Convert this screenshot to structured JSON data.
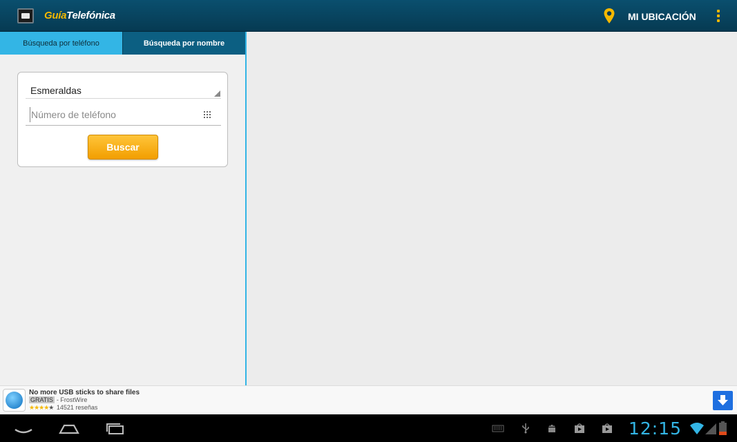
{
  "header": {
    "logo_part1": "Guía",
    "logo_part2": "Telefónica",
    "location_label": "MI UBICACIÓN"
  },
  "tabs": [
    {
      "label": "Búsqueda por teléfono",
      "selected": true
    },
    {
      "label": "Búsqueda por nombre",
      "selected": false
    }
  ],
  "search": {
    "province_value": "Esmeraldas",
    "phone_placeholder": "Número de teléfono",
    "phone_value": "",
    "button_label": "Buscar"
  },
  "ad": {
    "title": "No more USB sticks to share files",
    "price_badge": "GRATIS",
    "publisher": "- FrostWire",
    "rating": 4,
    "rating_max": 5,
    "reviews": "14521 reseñas"
  },
  "status_bar": {
    "time": "12:15"
  },
  "colors": {
    "action_bar": "#0a4f6e",
    "accent_yellow": "#f5b800",
    "holo_blue": "#33b5e5",
    "tab_dark": "#0c5f82",
    "button_orange": "#f29e00"
  }
}
